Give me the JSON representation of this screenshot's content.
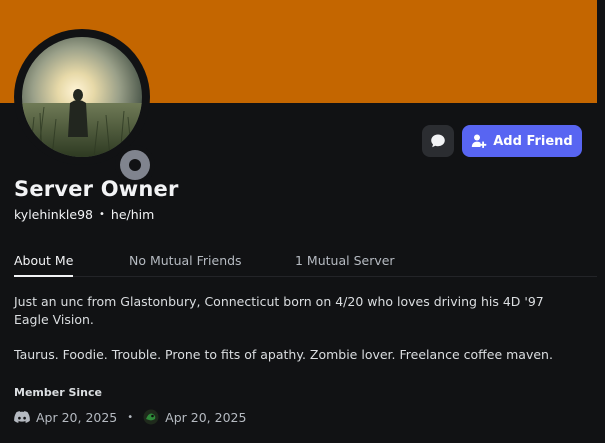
{
  "banner": {
    "color": "#c46600"
  },
  "profile": {
    "display_name": "Server Owner",
    "username": "kylehinkle98",
    "pronouns": "he/him",
    "status": "offline",
    "status_color": "#80848e"
  },
  "actions": {
    "message_icon": "chat-bubble-icon",
    "add_friend_label": "Add Friend",
    "add_friend_color": "#5865f2"
  },
  "tabs": [
    {
      "label": "About Me",
      "active": true
    },
    {
      "label": "No Mutual Friends",
      "active": false
    },
    {
      "label": "1 Mutual Server",
      "active": false
    }
  ],
  "about": {
    "bio_lines": [
      "Just an unc from Glastonbury, Connecticut born on 4/20 who loves driving his 4D '97 Eagle Vision.",
      "Taurus. Foodie. Trouble. Prone to fits of apathy. Zombie lover. Freelance coffee maven."
    ]
  },
  "member_since": {
    "heading": "Member Since",
    "discord_date": "Apr 20, 2025",
    "server_date": "Apr 20, 2025"
  }
}
